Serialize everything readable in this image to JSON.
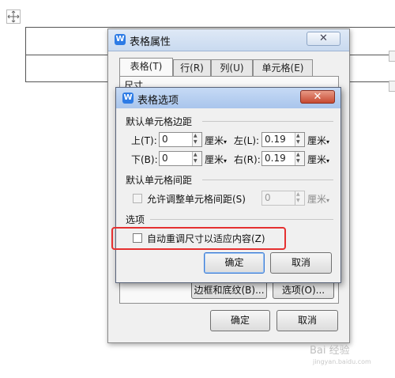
{
  "background": {
    "move_handle_icon": "move-cross-icon"
  },
  "outer_dialog": {
    "title": "表格属性",
    "app_icon_letter": "W",
    "close_glyph": "✕",
    "tabs": [
      {
        "label": "表格(T)",
        "active": true
      },
      {
        "label": "行(R)",
        "active": false
      },
      {
        "label": "列(U)",
        "active": false
      },
      {
        "label": "单元格(E)",
        "active": false
      }
    ],
    "section_label": "尺寸",
    "border_button": "边框和底纹(B)...",
    "options_button": "选项(O)...",
    "ok_button": "确定",
    "cancel_button": "取消"
  },
  "inner_dialog": {
    "title": "表格选项",
    "app_icon_letter": "W",
    "close_glyph": "✕",
    "margins_section": "默认单元格边距",
    "top_label": "上(T):",
    "top_value": "0",
    "left_label": "左(L):",
    "left_value": "0.19",
    "bottom_label": "下(B):",
    "bottom_value": "0",
    "right_label": "右(R):",
    "right_value": "0.19",
    "unit": "厘米",
    "spacing_section": "默认单元格间距",
    "allow_spacing_label": "允许调整单元格间距(S)",
    "spacing_value": "0",
    "spacing_unit": "厘米",
    "options_section": "选项",
    "autofit_label": "自动重调尺寸以适应内容(Z)",
    "ok_button": "确定",
    "cancel_button": "取消"
  },
  "watermark": {
    "text": "Bai 经验",
    "subtext": "jingyan.baidu.com"
  },
  "colors": {
    "highlight": "#e53030",
    "primary_button_border": "#3b7ad3",
    "titlebar": "#c9daf0",
    "inner_close": "#c74a32"
  }
}
